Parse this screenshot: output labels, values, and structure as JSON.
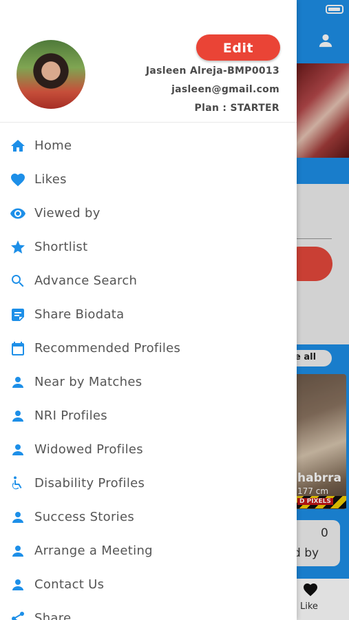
{
  "colors": {
    "accent": "#1d8fe8",
    "edit": "#ea4436",
    "text": "#555555"
  },
  "profile": {
    "edit_label": "Edit",
    "name": "Jasleen Alreja-BMP0013",
    "email": "jasleen@gmail.com",
    "plan": "Plan : STARTER"
  },
  "menu": [
    {
      "label": "Home",
      "icon": "home-icon"
    },
    {
      "label": "Likes",
      "icon": "heart-icon"
    },
    {
      "label": "Viewed by",
      "icon": "eye-icon"
    },
    {
      "label": "Shortlist",
      "icon": "star-icon"
    },
    {
      "label": "Advance Search",
      "icon": "search-icon"
    },
    {
      "label": "Share Biodata",
      "icon": "note-icon"
    },
    {
      "label": "Recommended Profiles",
      "icon": "calendar-icon"
    },
    {
      "label": "Near by Matches",
      "icon": "person-icon"
    },
    {
      "label": "NRI Profiles",
      "icon": "person-icon"
    },
    {
      "label": "Widowed Profiles",
      "icon": "person-icon"
    },
    {
      "label": "Disability Profiles",
      "icon": "wheelchair-icon"
    },
    {
      "label": "Success Stories",
      "icon": "person-icon"
    },
    {
      "label": "Arrange a Meeting",
      "icon": "person-icon"
    },
    {
      "label": "Contact Us",
      "icon": "person-icon"
    },
    {
      "label": "Share",
      "icon": "share-icon"
    }
  ],
  "background": {
    "see_all": "e all",
    "card_name": "habrra",
    "card_meta": "177 cm",
    "hazard_label": "D PIXELS",
    "stat_number": "0",
    "stat_label": "d by",
    "like_label": "Like"
  }
}
